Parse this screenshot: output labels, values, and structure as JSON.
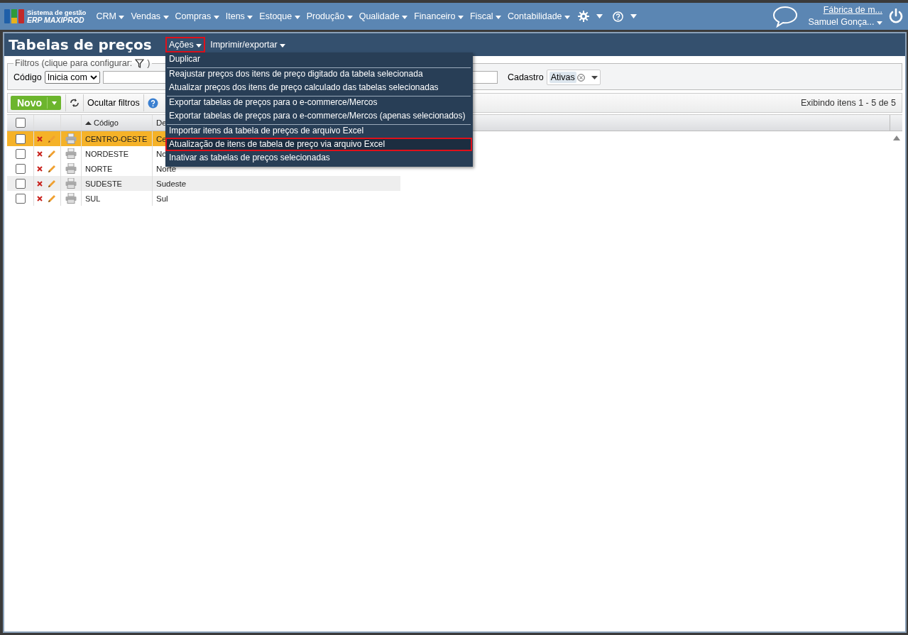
{
  "header": {
    "logo_top": "Sistema de gestão",
    "logo_bottom": "ERP MAXIPROD",
    "menus": [
      {
        "label": "CRM"
      },
      {
        "label": "Vendas"
      },
      {
        "label": "Compras"
      },
      {
        "label": "Itens"
      },
      {
        "label": "Estoque"
      },
      {
        "label": "Produção"
      },
      {
        "label": "Qualidade"
      },
      {
        "label": "Financeiro"
      },
      {
        "label": "Fiscal"
      },
      {
        "label": "Contabilidade"
      }
    ],
    "company": "Fábrica de m...",
    "user": "Samuel Gonça..."
  },
  "page": {
    "title": "Tabelas de preços",
    "actions": [
      {
        "label": "Ações",
        "highlighted": true
      },
      {
        "label": "Imprimir/exportar",
        "highlighted": false
      }
    ],
    "menu": [
      {
        "label": "Duplicar",
        "divider_before": false,
        "highlighted": false
      },
      {
        "label": "Reajustar preços dos itens de preço digitado da tabela selecionada",
        "divider_before": true,
        "highlighted": false
      },
      {
        "label": "Atualizar preços dos itens de preço calculado das tabelas selecionadas",
        "divider_before": false,
        "highlighted": false
      },
      {
        "label": "Exportar tabelas de preços para o e-commerce/Mercos",
        "divider_before": true,
        "highlighted": false
      },
      {
        "label": "Exportar tabelas de preços para o e-commerce/Mercos (apenas selecionados)",
        "divider_before": false,
        "highlighted": false
      },
      {
        "label": "Importar itens da tabela de preços de arquivo Excel",
        "divider_before": true,
        "highlighted": false
      },
      {
        "label": "Atualização de itens de tabela de preço via arquivo Excel",
        "divider_before": false,
        "highlighted": true
      },
      {
        "label": "Inativar as tabelas de preços selecionadas",
        "divider_before": false,
        "highlighted": false
      }
    ]
  },
  "filters": {
    "legend": "Filtros (clique para configurar:",
    "legend_end": ")",
    "code_label": "Código",
    "code_mode": "Inicia com",
    "status_label": "Cadastro",
    "status_tag": "Ativas"
  },
  "toolbar": {
    "new_button": "Novo",
    "hide_filters": "Ocultar filtros",
    "paging": "Exibindo itens 1 - 5 de 5"
  },
  "table": {
    "columns": [
      "Código",
      "De"
    ],
    "all_checked": false,
    "rows": [
      {
        "code": "CENTRO-OESTE",
        "description": "Ce",
        "selected": true,
        "hover": false,
        "checked": false
      },
      {
        "code": "NORDESTE",
        "description": "No",
        "selected": false,
        "hover": false,
        "checked": false
      },
      {
        "code": "NORTE",
        "description": "Norte",
        "selected": false,
        "hover": false,
        "checked": false
      },
      {
        "code": "SUDESTE",
        "description": "Sudeste",
        "selected": false,
        "hover": true,
        "checked": false
      },
      {
        "code": "SUL",
        "description": "Sul",
        "selected": false,
        "hover": false,
        "checked": false
      }
    ]
  }
}
